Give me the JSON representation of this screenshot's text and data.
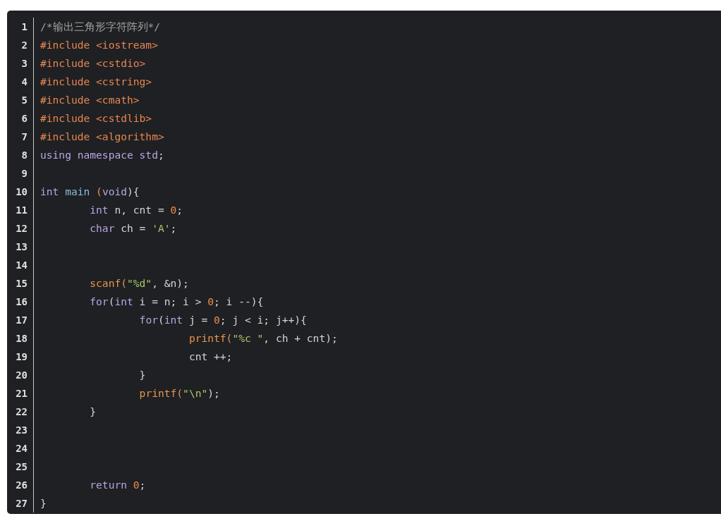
{
  "code_lines": [
    {
      "number": "1",
      "tokens": [
        {
          "kind": "comment",
          "text": "/*输出三角形字符阵列*/"
        }
      ]
    },
    {
      "number": "2",
      "tokens": [
        {
          "kind": "preprocessor",
          "text": "#include <iostream>"
        }
      ]
    },
    {
      "number": "3",
      "tokens": [
        {
          "kind": "preprocessor",
          "text": "#include <cstdio>"
        }
      ]
    },
    {
      "number": "4",
      "tokens": [
        {
          "kind": "preprocessor",
          "text": "#include <cstring>"
        }
      ]
    },
    {
      "number": "5",
      "tokens": [
        {
          "kind": "preprocessor",
          "text": "#include <cmath>"
        }
      ]
    },
    {
      "number": "6",
      "tokens": [
        {
          "kind": "preprocessor",
          "text": "#include <cstdlib>"
        }
      ]
    },
    {
      "number": "7",
      "tokens": [
        {
          "kind": "preprocessor",
          "text": "#include <algorithm>"
        }
      ]
    },
    {
      "number": "8",
      "tokens": [
        {
          "kind": "keyword",
          "text": "using namespace std"
        },
        {
          "kind": "plain",
          "text": ";"
        }
      ]
    },
    {
      "number": "9"
    },
    {
      "number": "10",
      "tokens": [
        {
          "kind": "keyword",
          "text": "int"
        },
        {
          "kind": "name",
          "text": " main "
        },
        {
          "kind": "function",
          "text": "("
        },
        {
          "kind": "keyword",
          "text": "void"
        },
        {
          "kind": "plain",
          "text": "){"
        }
      ]
    },
    {
      "number": "11",
      "tokens": [
        {
          "kind": "keyword",
          "text": "\tint"
        },
        {
          "kind": "plain",
          "text": " n, cnt = "
        },
        {
          "kind": "number",
          "text": "0"
        },
        {
          "kind": "plain",
          "text": ";"
        }
      ]
    },
    {
      "number": "12",
      "tokens": [
        {
          "kind": "keyword",
          "text": "\tchar"
        },
        {
          "kind": "plain",
          "text": " ch = "
        },
        {
          "kind": "string",
          "text": "'A'"
        },
        {
          "kind": "plain",
          "text": ";"
        }
      ]
    },
    {
      "number": "13"
    },
    {
      "number": "14"
    },
    {
      "number": "15",
      "tokens": [
        {
          "kind": "function",
          "text": "\tscanf("
        },
        {
          "kind": "string",
          "text": "\"%d\""
        },
        {
          "kind": "plain",
          "text": ", &n);"
        }
      ]
    },
    {
      "number": "16",
      "tokens": [
        {
          "kind": "keyword",
          "text": "\tfor"
        },
        {
          "kind": "plain",
          "text": "("
        },
        {
          "kind": "keyword",
          "text": "int"
        },
        {
          "kind": "plain",
          "text": " i = n; i > "
        },
        {
          "kind": "number",
          "text": "0"
        },
        {
          "kind": "plain",
          "text": "; i --){"
        }
      ]
    },
    {
      "number": "17",
      "tokens": [
        {
          "kind": "keyword",
          "text": "\t\tfor"
        },
        {
          "kind": "plain",
          "text": "("
        },
        {
          "kind": "keyword",
          "text": "int"
        },
        {
          "kind": "plain",
          "text": " j = "
        },
        {
          "kind": "number",
          "text": "0"
        },
        {
          "kind": "plain",
          "text": "; j < i; j++){"
        }
      ]
    },
    {
      "number": "18",
      "tokens": [
        {
          "kind": "function",
          "text": "\t\t\tprintf("
        },
        {
          "kind": "string",
          "text": "\"%c \""
        },
        {
          "kind": "plain",
          "text": ", ch + cnt);"
        }
      ]
    },
    {
      "number": "19",
      "tokens": [
        {
          "kind": "plain",
          "text": "\t\t\tcnt ++;"
        }
      ]
    },
    {
      "number": "20",
      "tokens": [
        {
          "kind": "plain",
          "text": "\t\t}"
        }
      ]
    },
    {
      "number": "21",
      "tokens": [
        {
          "kind": "function",
          "text": "\t\tprintf("
        },
        {
          "kind": "string",
          "text": "\"\\n\""
        },
        {
          "kind": "plain",
          "text": ");"
        }
      ]
    },
    {
      "number": "22",
      "tokens": [
        {
          "kind": "plain",
          "text": "\t}"
        }
      ]
    },
    {
      "number": "23"
    },
    {
      "number": "24"
    },
    {
      "number": "25"
    },
    {
      "number": "26",
      "tokens": [
        {
          "kind": "keyword",
          "text": "\treturn "
        },
        {
          "kind": "number",
          "text": "0"
        },
        {
          "kind": "plain",
          "text": ";"
        }
      ]
    },
    {
      "number": "27",
      "tokens": [
        {
          "kind": "plain",
          "text": "}"
        }
      ]
    }
  ]
}
